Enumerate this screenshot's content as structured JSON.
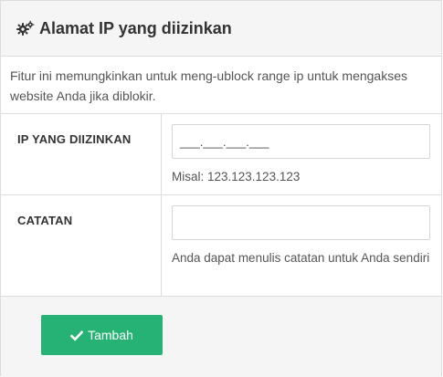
{
  "panel": {
    "title": "Alamat IP yang diizinkan",
    "icon": "cogs-icon"
  },
  "intro": {
    "text": "Fitur ini memungkinkan untuk meng-ublock range ip untuk mengakses website Anda jika diblokir."
  },
  "ip_field": {
    "label": "IP YANG DIIZINKAN",
    "value": "___.___.___.___",
    "help": "Misal: 123.123.123.123"
  },
  "note_field": {
    "label": "CATATAN",
    "value": "",
    "help": "Anda dapat menulis catatan untuk Anda sendiri"
  },
  "actions": {
    "add_label": "Tambah",
    "add_icon": "check-icon",
    "add_color": "#26b274"
  }
}
